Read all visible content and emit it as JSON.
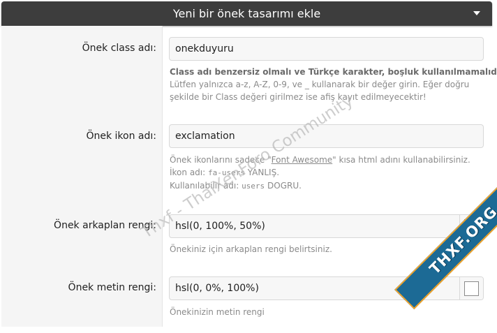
{
  "header": {
    "title": "Yeni bir önek tasarımı ekle"
  },
  "fields": {
    "class_name": {
      "label": "Önek class adı:",
      "value": "onekduyuru",
      "help_bold": "Class adı benzersiz olmalı ve Türkçe karakter, boşluk kullanılmamalıdır.",
      "help_line1": "Lütfen yalnızca a-z, A-Z, 0-9, ve _ kullanarak bir değer girin. Eğer doğru",
      "help_line2": "şekilde bir Class değeri girilmez ise afiş kayıt edilmeyecektir!"
    },
    "icon_name": {
      "label": "Önek ikon adı:",
      "value": "exclamation",
      "help_pre": "Önek ikonlarını sadece \"",
      "help_link": "Font Awesome",
      "help_post": "\" kısa html adını kullanabilirsiniz.",
      "help_l2_pre": "İkon adı: ",
      "help_l2_code": "fa-users",
      "help_l2_post": " YANLIŞ.",
      "help_l3_pre": "Kullanılabilir adı: ",
      "help_l3_code": "users",
      "help_l3_post": " DOGRU."
    },
    "bg_color": {
      "label": "Önek arkaplan rengi:",
      "value": "hsl(0, 100%, 50%)",
      "swatch_color": "#ff0000",
      "help": "Önekiniz için arkaplan rengi belirtsiniz."
    },
    "text_color": {
      "label": "Önek metin rengi:",
      "value": "hsl(0, 0%, 100%)",
      "swatch_color": "#ffffff",
      "help": "Önekinizin metin rengi"
    }
  },
  "watermark": {
    "text": "Thxf - ThaiXenForo Community",
    "ribbon": "THXF.ORG"
  }
}
